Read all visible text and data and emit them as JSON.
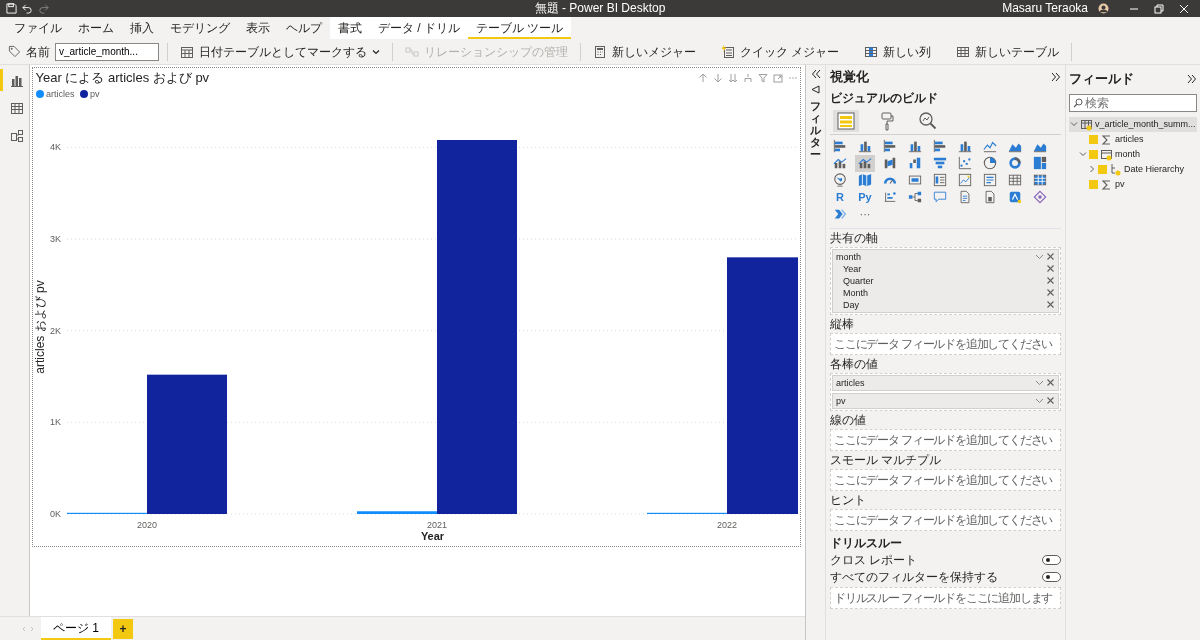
{
  "window": {
    "title": "無題 - Power BI Desktop",
    "user": "Masaru Teraoka"
  },
  "ribbon_tabs": [
    {
      "label": "ファイル",
      "kind": "standard",
      "selected": false
    },
    {
      "label": "ホーム",
      "kind": "standard",
      "selected": false
    },
    {
      "label": "挿入",
      "kind": "standard",
      "selected": false
    },
    {
      "label": "モデリング",
      "kind": "standard",
      "selected": false
    },
    {
      "label": "表示",
      "kind": "standard",
      "selected": false
    },
    {
      "label": "ヘルプ",
      "kind": "standard",
      "selected": false
    },
    {
      "label": "書式",
      "kind": "contextual",
      "selected": false
    },
    {
      "label": "データ / ドリル",
      "kind": "contextual",
      "selected": false
    },
    {
      "label": "テーブル ツール",
      "kind": "contextual",
      "selected": true
    }
  ],
  "toolbar": {
    "name_field": {
      "label": "名前",
      "value": "v_article_month..."
    },
    "buttons": [
      {
        "label": "日付テーブルとしてマークする",
        "kind": "calendar",
        "dropdown": true,
        "disabled": false,
        "separator_after": true
      },
      {
        "label": "リレーションシップの管理",
        "kind": "relationship",
        "dropdown": false,
        "disabled": true,
        "separator_after": true
      },
      {
        "label": "新しいメジャー",
        "kind": "measure",
        "dropdown": false,
        "disabled": false,
        "separator_after": false
      },
      {
        "label": "クイック メジャー",
        "kind": "quick-measure",
        "dropdown": false,
        "disabled": false,
        "separator_after": false
      },
      {
        "label": "新しい列",
        "kind": "column",
        "dropdown": false,
        "disabled": false,
        "separator_after": false
      },
      {
        "label": "新しいテーブル",
        "kind": "table",
        "dropdown": false,
        "disabled": false,
        "separator_after": true
      }
    ]
  },
  "left_rail": [
    {
      "kind": "report",
      "selected": true
    },
    {
      "kind": "data",
      "selected": false
    },
    {
      "kind": "model",
      "selected": false
    }
  ],
  "visual": {
    "title": "Year による articles および pv",
    "chart_data": {
      "type": "bar",
      "xlabel": "Year",
      "ylabel": "articles および pv",
      "categories": [
        "2020",
        "2021",
        "2022"
      ],
      "grid": true,
      "series": [
        {
          "name": "articles",
          "color": "#118dff",
          "values": [
            10,
            30,
            10
          ]
        },
        {
          "name": "pv",
          "color": "#12239e",
          "values": [
            1520,
            4080,
            2800
          ]
        }
      ],
      "ylim": [
        0,
        4080
      ],
      "yticks": [
        {
          "value": 0,
          "label": "0K"
        },
        {
          "value": 1000,
          "label": "1K"
        },
        {
          "value": 2000,
          "label": "2K"
        },
        {
          "value": 3000,
          "label": "3K"
        },
        {
          "value": 4000,
          "label": "4K"
        }
      ]
    }
  },
  "filters_pane": {
    "label": "フィルター"
  },
  "visualizations": {
    "title": "視覚化",
    "subtitle": "ビジュアルのビルド",
    "modes": [
      {
        "kind": "build",
        "selected": true
      },
      {
        "kind": "format",
        "selected": false
      },
      {
        "kind": "analytics",
        "selected": false
      }
    ],
    "gallery": [
      {
        "kind": "hbar",
        "selected": false
      },
      {
        "kind": "vbar",
        "selected": false
      },
      {
        "kind": "hbar",
        "selected": false
      },
      {
        "kind": "vbar",
        "selected": false
      },
      {
        "kind": "hbar",
        "selected": false
      },
      {
        "kind": "vbar",
        "selected": false
      },
      {
        "kind": "line",
        "selected": false
      },
      {
        "kind": "area",
        "selected": false
      },
      {
        "kind": "area",
        "selected": false
      },
      {
        "kind": "combo",
        "selected": false
      },
      {
        "kind": "combo",
        "selected": true
      },
      {
        "kind": "ribbon",
        "selected": false
      },
      {
        "kind": "waterfall",
        "selected": false
      },
      {
        "kind": "funnel",
        "selected": false
      },
      {
        "kind": "scatter",
        "selected": false
      },
      {
        "kind": "pie",
        "selected": false
      },
      {
        "kind": "donut",
        "selected": false
      },
      {
        "kind": "treemap",
        "selected": false
      },
      {
        "kind": "map",
        "selected": false
      },
      {
        "kind": "filledmap",
        "selected": false
      },
      {
        "kind": "gauge",
        "selected": false
      },
      {
        "kind": "card",
        "selected": false
      },
      {
        "kind": "multicard",
        "selected": false
      },
      {
        "kind": "kpi",
        "selected": false
      },
      {
        "kind": "slicer",
        "selected": false
      },
      {
        "kind": "table",
        "selected": false
      },
      {
        "kind": "matrix",
        "selected": false
      },
      {
        "kind": "text",
        "label": "R",
        "selected": false
      },
      {
        "kind": "text",
        "label": "Py",
        "selected": false
      },
      {
        "kind": "influencers",
        "selected": false
      },
      {
        "kind": "decomposition",
        "selected": false
      },
      {
        "kind": "qa",
        "selected": false
      },
      {
        "kind": "narrative",
        "selected": false
      },
      {
        "kind": "paginated",
        "selected": false
      },
      {
        "kind": "apps",
        "selected": false
      },
      {
        "kind": "diamond",
        "selected": false
      },
      {
        "kind": "automate",
        "selected": false
      },
      {
        "kind": "text",
        "label": "···",
        "selected": false
      }
    ],
    "wells": [
      {
        "label": "共有の軸",
        "fields": [
          {
            "name": "month",
            "children": [
              "Year",
              "Quarter",
              "Month",
              "Day"
            ]
          }
        ]
      },
      {
        "label": "縦棒",
        "placeholder": "ここにデータ フィールドを追加してください"
      },
      {
        "label": "各棒の値",
        "fields": [
          {
            "name": "articles"
          },
          {
            "name": "pv"
          }
        ]
      },
      {
        "label": "線の値",
        "placeholder": "ここにデータ フィールドを追加してください"
      },
      {
        "label": "スモール マルチプル",
        "placeholder": "ここにデータ フィールドを追加してください"
      },
      {
        "label": "ヒント",
        "placeholder": "ここにデータ フィールドを追加してください"
      }
    ],
    "drillthrough": {
      "title": "ドリルスルー",
      "toggles": [
        {
          "label": "クロス レポート",
          "on": false
        },
        {
          "label": "すべてのフィルターを保持する",
          "on": false
        }
      ],
      "placeholder": "ドリルスルー フィールドをここに追加します"
    }
  },
  "fields_pane": {
    "title": "フィールド",
    "search": {
      "placeholder": "検索"
    },
    "tree": [
      {
        "name": "v_article_month_summ...",
        "kind": "table",
        "expanded": true,
        "selected": true,
        "children": [
          {
            "name": "articles",
            "kind": "measure",
            "checked": true,
            "selected": false
          },
          {
            "name": "month",
            "kind": "date",
            "checked": true,
            "expanded": true,
            "selected": false,
            "children": [
              {
                "name": "Date Hierarchy",
                "kind": "hierarchy",
                "checked": true,
                "expanded": false,
                "selected": false
              }
            ]
          },
          {
            "name": "pv",
            "kind": "measure",
            "checked": true,
            "selected": false
          }
        ]
      }
    ]
  },
  "pages": [
    {
      "label": "ページ 1",
      "selected": true
    }
  ],
  "add_page": "+"
}
